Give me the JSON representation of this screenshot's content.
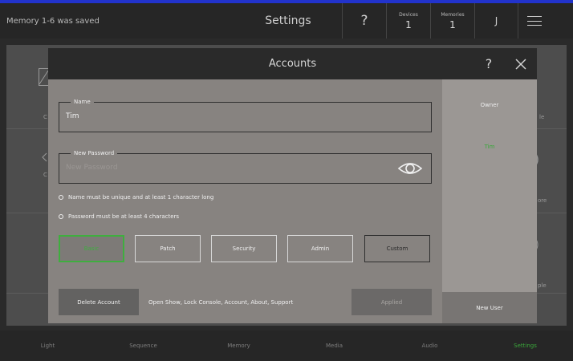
{
  "header": {
    "status_text": "Memory 1-6 was saved",
    "title": "Settings",
    "help_glyph": "?",
    "devices": {
      "label": "Devices",
      "value": "1"
    },
    "memories": {
      "label": "Memories",
      "value": "1"
    },
    "user_initial": "J",
    "menu_icon": "hamburger-icon",
    "accent_color": "#2233cc"
  },
  "modal": {
    "title": "Accounts",
    "help_glyph": "?",
    "close_icon": "close-icon",
    "name_field": {
      "legend": "Name",
      "value": "Tim"
    },
    "password_field": {
      "legend": "New Password",
      "placeholder": "New Password",
      "toggle_icon": "eye-icon"
    },
    "rules": [
      "Name must be unique and at least 1 character long",
      "Password must be at least 4 characters"
    ],
    "roles": [
      {
        "label": "Basic"
      },
      {
        "label": "Patch"
      },
      {
        "label": "Security"
      },
      {
        "label": "Admin"
      },
      {
        "label": "Custom"
      }
    ],
    "selected_role": "Basic",
    "delete_label": "Delete Account",
    "permissions_text": "Open Show, Lock Console, Account, About, Support",
    "applied_label": "Applied",
    "users_panel": {
      "owner_label": "Owner",
      "users": [
        "Tim"
      ],
      "new_user_label": "New User"
    },
    "highlight_color": "#3fae3f"
  },
  "background": {
    "visible_fragments": [
      "C",
      "le",
      "C",
      "ore",
      "ple"
    ]
  },
  "bottom_nav": {
    "items": [
      "Light",
      "Sequence",
      "Memory",
      "Media",
      "Audio",
      "Settings"
    ],
    "active": "Settings"
  }
}
